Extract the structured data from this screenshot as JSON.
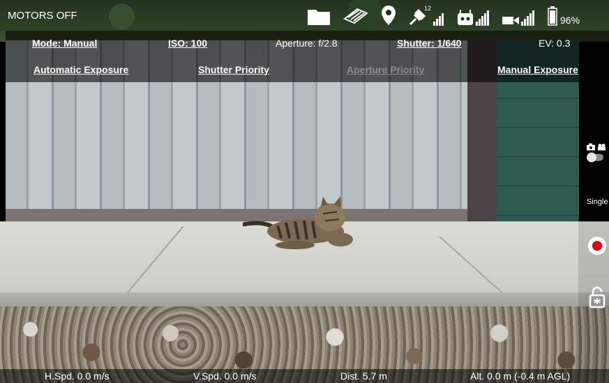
{
  "status_bar": {
    "motors": "MOTORS OFF",
    "icons": [
      "folder-icon",
      "map-layers-icon",
      "location-pin-icon",
      "satellite-icon",
      "remote-controller-icon",
      "video-link-icon",
      "battery-icon"
    ],
    "gps_satellite_count": "12",
    "battery_percent": "96%"
  },
  "exposure": {
    "mode": "Mode: Manual",
    "iso": "ISO: 100",
    "aperture": "Aperture: f/2.8",
    "shutter": "Shutter: 1/640",
    "ev": "EV: 0.3"
  },
  "exposure_modes": [
    {
      "label": "Automatic Exposure",
      "enabled": true
    },
    {
      "label": "Shutter Priority",
      "enabled": true
    },
    {
      "label": "Aperture Priority",
      "enabled": false
    },
    {
      "label": "Manual Exposure",
      "enabled": true
    }
  ],
  "camera_controls": {
    "icons": [
      "photo-mode-icon",
      "video-mode-icon",
      "record-icon",
      "unlock-icon"
    ],
    "shoot_mode": "Single"
  },
  "telemetry": {
    "h_speed": "H.Spd. 0.0 m/s",
    "v_speed": "V.Spd. 0.0 m/s",
    "distance": "Dist. 5.7 m",
    "altitude": "Alt. 0.0 m (-0.4 m AGL)"
  },
  "colors": {
    "record": "#e3000f",
    "disabled_text": "#8c8c8c"
  }
}
